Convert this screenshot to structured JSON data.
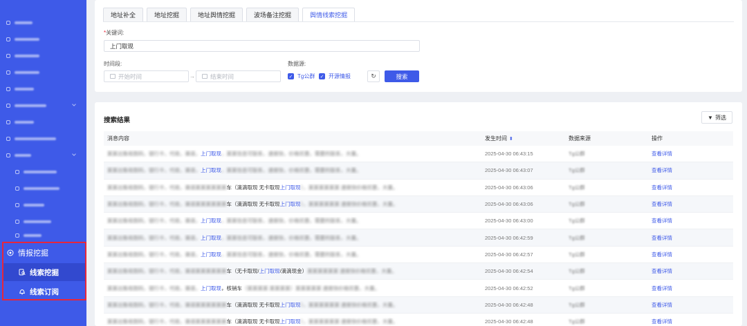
{
  "sidebar": {
    "group_label": "情报挖掘",
    "sub_items": [
      {
        "label": "线索挖掘"
      },
      {
        "label": "线索订阅"
      }
    ]
  },
  "tabs": [
    {
      "label": "地址补全"
    },
    {
      "label": "地址挖掘"
    },
    {
      "label": "地址舆情挖掘"
    },
    {
      "label": "波场备注挖掘"
    },
    {
      "label": "舆情线索挖掘"
    }
  ],
  "form": {
    "keyword_required_mark": "*",
    "keyword_label": "关键词:",
    "keyword_value": "上门取现",
    "time_label": "时间段:",
    "start_placeholder": "开始时间",
    "end_placeholder": "结束时间",
    "range_separator": "→",
    "source_label": "数据源:",
    "sources": [
      {
        "label": "Tg公群",
        "checked": true
      },
      {
        "label": "开源情报",
        "checked": true
      }
    ],
    "search_label": "搜索"
  },
  "results": {
    "title": "搜索结果",
    "filter_label": "筛选",
    "columns": [
      "消息内容",
      "发生时间",
      "数据来源",
      "操作"
    ],
    "rows": [
      {
        "pre": "某某出售收款码，银行卡，代收，渠道，",
        "kw": "上门取现",
        "post": "，某某信息可联系，速度快，价格优惠，需要的联系，大量。",
        "time": "2025-04-30 06:43:15",
        "source": "Tg公群",
        "action": "查看详情"
      },
      {
        "pre": "某某出售收款码，银行卡，代收，渠道，",
        "kw": "上门取现",
        "post": "，某某信息可联系，速度快，价格优惠，需要的联系，大量。",
        "time": "2025-04-30 06:43:07",
        "source": "Tg公群",
        "action": "查看详情"
      },
      {
        "pre": "某某出售收款码，银行卡，代收，渠道某某某某某某",
        "mid": "车（滴滴取现 无卡取现 ",
        "kw": "上门取现",
        "post": "），某某某某某某 速度快价格优惠，大量。",
        "time": "2025-04-30 06:43:06",
        "source": "Tg公群",
        "action": "查看详情"
      },
      {
        "pre": "某某出售收款码，银行卡，代收，渠道某某某某某某",
        "mid": "车（滴滴取现 无卡取现 ",
        "kw": "上门取现",
        "post": "），某某某某某某 速度快价格优惠，大量。",
        "time": "2025-04-30 06:43:06",
        "source": "Tg公群",
        "action": "查看详情"
      },
      {
        "pre": "某某出售收款码，银行卡，代收，渠道，",
        "kw": "上门取现",
        "post": "，某某信息可联系，速度快，价格优惠，需要的联系，大量。",
        "time": "2025-04-30 06:43:00",
        "source": "Tg公群",
        "action": "查看详情"
      },
      {
        "pre": "某某出售收款码，银行卡，代收，渠道，",
        "kw": "上门取现",
        "post": "，某某信息可联系，速度快，价格优惠，需要的联系，大量。",
        "time": "2025-04-30 06:42:59",
        "source": "Tg公群",
        "action": "查看详情"
      },
      {
        "pre": "某某出售收款码，银行卡，代收，渠道，",
        "kw": "上门取现",
        "post": "，某某信息可联系，速度快，价格优惠，需要的联系，大量。",
        "time": "2025-04-30 06:42:57",
        "source": "Tg公群",
        "action": "查看详情"
      },
      {
        "pre": "某某出售收款码，银行卡，代收，渠道某某某某某某",
        "mid": "车（无卡取现/",
        "kw": "上门取现",
        "post2": "/滴滴现金）",
        "post": "某某某某某某 速度快价格优惠，大量。",
        "time": "2025-04-30 06:42:54",
        "source": "Tg公群",
        "action": "查看详情"
      },
      {
        "pre": "某某出售收款码，银行卡，代收，渠道，",
        "kw": "上门取现",
        "post2": "，核销车",
        "post": "（某某某某 某某某某）某某某某某 速度快价格优惠，大量。",
        "time": "2025-04-30 06:42:52",
        "source": "Tg公群",
        "action": "查看详情"
      },
      {
        "pre": "某某出售收款码，银行卡，代收，渠道某某某某某某",
        "mid": "车（滴滴取现 无卡取现 ",
        "kw": "上门取现",
        "post": "），某某某某某某 速度快价格优惠，大量。",
        "time": "2025-04-30 06:42:48",
        "source": "Tg公群",
        "action": "查看详情"
      },
      {
        "pre": "某某出售收款码，银行卡，代收，渠道某某某某某某",
        "mid": "车（滴滴取现 无卡取现 ",
        "kw": "上门取现",
        "post": "），某某某某某某 速度快价格优惠，大量。",
        "time": "2025-04-30 06:42:48",
        "source": "Tg公群",
        "action": "查看详情"
      }
    ]
  }
}
